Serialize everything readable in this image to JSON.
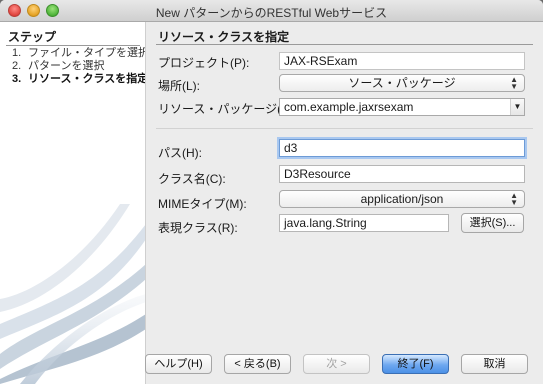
{
  "window": {
    "title": "New パターンからのRESTful Webサービス"
  },
  "sidebar": {
    "title": "ステップ",
    "steps": [
      {
        "num": "1.",
        "label": "ファイル・タイプを選択"
      },
      {
        "num": "2.",
        "label": "パターンを選択"
      },
      {
        "num": "3.",
        "label": "リソース・クラスを指定"
      }
    ]
  },
  "panel": {
    "title": "リソース・クラスを指定",
    "project": {
      "label": "プロジェクト(P):",
      "value": "JAX-RSExam"
    },
    "location": {
      "label": "場所(L):",
      "value": "ソース・パッケージ"
    },
    "package": {
      "label": "リソース・パッケージ(K):",
      "value": "com.example.jaxrsexam"
    },
    "path": {
      "label": "パス(H):",
      "value": "d3"
    },
    "class_name": {
      "label": "クラス名(C):",
      "value": "D3Resource"
    },
    "mime": {
      "label": "MIMEタイプ(M):",
      "value": "application/json"
    },
    "repr": {
      "label": "表現クラス(R):",
      "value": "java.lang.String",
      "select_label": "選択(S)..."
    }
  },
  "buttons": {
    "help": "ヘルプ(H)",
    "back": "< 戻る(B)",
    "next": "次 >",
    "finish": "終了(F)",
    "cancel": "取消"
  },
  "colors": {
    "accent": "#4c90e6",
    "focus_ring": "#a9c8f0"
  }
}
